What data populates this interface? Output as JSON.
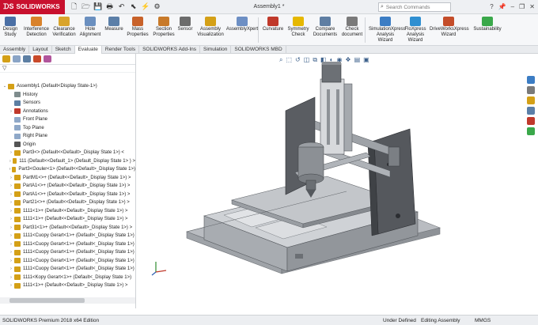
{
  "app": {
    "logo": "SOLIDWORKS",
    "document_title": "Assembly1 *",
    "search_placeholder": "Search Commands"
  },
  "ribbon": {
    "buttons": [
      {
        "label": "Design Study",
        "icon": "design-study-icon",
        "color": "#4a6fa5"
      },
      {
        "label": "Interference Detection",
        "icon": "interference-icon",
        "color": "#d9822b"
      },
      {
        "label": "Clearance Verification",
        "icon": "clearance-icon",
        "color": "#d9a42b"
      },
      {
        "label": "Hole Alignment",
        "icon": "hole-alignment-icon",
        "color": "#6a8fbf"
      },
      {
        "label": "Measure",
        "icon": "measure-icon",
        "color": "#5b7fa8"
      },
      {
        "label": "Mass Properties",
        "icon": "mass-properties-icon",
        "color": "#c8622a"
      },
      {
        "label": "Section Properties",
        "icon": "section-properties-icon",
        "color": "#c87a2a"
      },
      {
        "label": "Sensor",
        "icon": "sensor-icon",
        "color": "#6c6c6c"
      },
      {
        "label": "Assembly Visualization",
        "icon": "assembly-visualization-icon",
        "color": "#d4a017"
      },
      {
        "label": "AssemblyXpert",
        "icon": "assemblyxpert-icon",
        "color": "#6d8fc4"
      },
      {
        "label": "Curvature",
        "icon": "curvature-icon",
        "color": "#c0392b"
      },
      {
        "label": "Symmetry Check",
        "icon": "symmetry-check-icon",
        "color": "#e6b800"
      },
      {
        "label": "Compare Documents",
        "icon": "compare-documents-icon",
        "color": "#5f7ea3"
      },
      {
        "label": "Check document",
        "icon": "check-document-icon",
        "color": "#7a7a7a"
      },
      {
        "label": "SimulationXpress Analysis Wizard",
        "icon": "simulationxpress-icon",
        "color": "#3c7dc4"
      },
      {
        "label": "FloXpress Analysis Wizard",
        "icon": "floxpress-icon",
        "color": "#2f8fd1"
      },
      {
        "label": "DriveWorksXpress Wizard",
        "icon": "driveworksxpress-icon",
        "color": "#c44d2a"
      },
      {
        "label": "Sustainability",
        "icon": "sustainability-icon",
        "color": "#3aa84a"
      }
    ]
  },
  "tabs": [
    "Assembly",
    "Layout",
    "Sketch",
    "Evaluate",
    "Render Tools",
    "SOLIDWORKS Add-Ins",
    "Simulation",
    "SOLIDWORKS MBD"
  ],
  "active_tab": "Evaluate",
  "tree": {
    "filter_icon": "filter-icon",
    "items": [
      {
        "label": "Assembly1 (Default<Display State-1>)",
        "icon": "assembly-icon",
        "expand": "⌄",
        "indent": 0,
        "color": "#d4a017"
      },
      {
        "label": "History",
        "icon": "history-icon",
        "expand": "",
        "indent": 1,
        "color": "#7f8c8d"
      },
      {
        "label": "Sensors",
        "icon": "sensors-icon",
        "expand": "",
        "indent": 1,
        "color": "#5d7fa3"
      },
      {
        "label": "Annotations",
        "icon": "annotations-icon",
        "expand": "›",
        "indent": 1,
        "color": "#c0392b"
      },
      {
        "label": "Front Plane",
        "icon": "plane-icon",
        "expand": "",
        "indent": 1,
        "color": "#8fa8c8"
      },
      {
        "label": "Top Plane",
        "icon": "plane-icon",
        "expand": "",
        "indent": 1,
        "color": "#8fa8c8"
      },
      {
        "label": "Right Plane",
        "icon": "plane-icon",
        "expand": "",
        "indent": 1,
        "color": "#8fa8c8"
      },
      {
        "label": "Origin",
        "icon": "origin-icon",
        "expand": "",
        "indent": 1,
        "color": "#555555"
      },
      {
        "label": "Part3<> (Default<<Default>_Display State 1>) <",
        "icon": "part-icon",
        "expand": "›",
        "indent": 1,
        "color": "#d4a017"
      },
      {
        "label": "111 (Default<<Default_1> (Default_Display State 1> ) >",
        "icon": "part-icon",
        "expand": "›",
        "indent": 1,
        "color": "#d4a017"
      },
      {
        "label": "Part3<Gouler<1> (Default<<Default>_Display State 1>)",
        "icon": "part-icon",
        "expand": "›",
        "indent": 1,
        "color": "#d4a017"
      },
      {
        "label": "PartM1<>+ (Default<<Default>_Display State 1>) >",
        "icon": "part-icon",
        "expand": "›",
        "indent": 1,
        "color": "#d4a017"
      },
      {
        "label": "PartA1<>+ (Default<<Default>_Display State 1>) >",
        "icon": "part-icon",
        "expand": "›",
        "indent": 1,
        "color": "#d4a017"
      },
      {
        "label": "PartA1<>+ (Default<<Default>_Display State 1>) >",
        "icon": "part-icon",
        "expand": "›",
        "indent": 1,
        "color": "#d4a017"
      },
      {
        "label": "Part21<>+ (Default<<Default>_Display State 1>) >",
        "icon": "part-icon",
        "expand": "›",
        "indent": 1,
        "color": "#d4a017"
      },
      {
        "label": "1111<1>+ (Default<<Default>_Display State 1>) >",
        "icon": "part-icon",
        "expand": "›",
        "indent": 1,
        "color": "#d4a017"
      },
      {
        "label": "1111<1>+ (Default<<Default>_Display State 1>) >",
        "icon": "part-icon",
        "expand": "›",
        "indent": 1,
        "color": "#d4a017"
      },
      {
        "label": "Part31<1>+ (Default<<Default>_Display State 1>) >",
        "icon": "part-icon",
        "expand": "›",
        "indent": 1,
        "color": "#d4a017"
      },
      {
        "label": "1111<Cuopy Gerart<1>+ (Default<_Display State 1>)",
        "icon": "part-icon",
        "expand": "›",
        "indent": 1,
        "color": "#d4a017"
      },
      {
        "label": "1111<Cuopy Gerart<1>+ (Default<_Display State 1>)",
        "icon": "part-icon",
        "expand": "›",
        "indent": 1,
        "color": "#d4a017"
      },
      {
        "label": "1111<Cuopy Gerart<1>+ (Default<_Display State 1>)",
        "icon": "part-icon",
        "expand": "›",
        "indent": 1,
        "color": "#d4a017"
      },
      {
        "label": "1111<Cuopy Gerart<1>+ (Default<_Display State 1>)",
        "icon": "part-icon",
        "expand": "›",
        "indent": 1,
        "color": "#d4a017"
      },
      {
        "label": "1111<Cuopy Gerart<1>+ (Default<_Display State 1>)",
        "icon": "part-icon",
        "expand": "›",
        "indent": 1,
        "color": "#d4a017"
      },
      {
        "label": "1111<Kopy Gerart<1>+ (Default<_Display State 1>)",
        "icon": "part-icon",
        "expand": "›",
        "indent": 1,
        "color": "#d4a017"
      },
      {
        "label": "1111<1>+ (Default<<Default>_Display State 1>) >",
        "icon": "part-icon",
        "expand": "›",
        "indent": 1,
        "color": "#d4a017"
      }
    ]
  },
  "status": {
    "edition": "SOLIDWORKS Premium 2018 x64 Edition",
    "definition": "Under Defined",
    "mode": "Editing Assembly",
    "units": "MMGS"
  },
  "hud_icons": [
    "magnify-icon",
    "zoom-area-icon",
    "previous-view-icon",
    "section-view-icon",
    "view-orientation-icon",
    "display-style-icon",
    "hide-show-icon",
    "edit-appearance-icon",
    "scene-icon",
    "view-settings-icon",
    "display-icon"
  ],
  "task_pane_icons": [
    {
      "icon": "resources-icon",
      "color": "#3c7dc4"
    },
    {
      "icon": "design-library-icon",
      "color": "#7a7a7a"
    },
    {
      "icon": "file-explorer-icon",
      "color": "#d4a017"
    },
    {
      "icon": "view-palette-icon",
      "color": "#5b7fa8"
    },
    {
      "icon": "appearances-icon",
      "color": "#c0392b"
    },
    {
      "icon": "custom-properties-icon",
      "color": "#3aa84a"
    }
  ]
}
